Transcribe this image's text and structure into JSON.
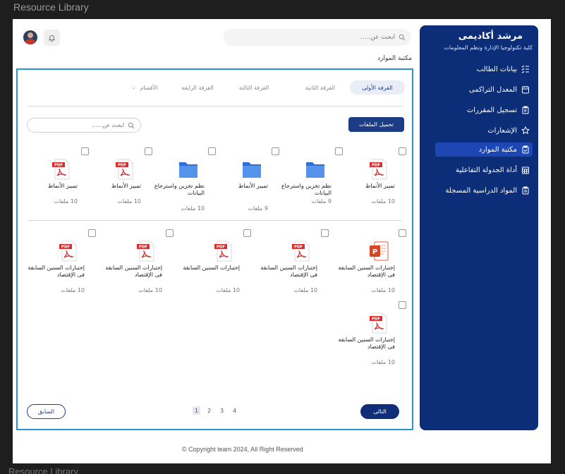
{
  "window": {
    "title": "Resource Library",
    "bottom_title": "Resource Library"
  },
  "sidebar": {
    "title": "مرشد أكاديمى",
    "subtitle": "كلية تكنولوجيا الإدارة ونظم المعلومات",
    "items": [
      {
        "label": "بيانات الطالب",
        "icon": "list-check-icon"
      },
      {
        "label": "المعدل التراكمى",
        "icon": "calendar-icon"
      },
      {
        "label": "تسجيل المقررات",
        "icon": "clipboard-icon"
      },
      {
        "label": "الإشعارات",
        "icon": "star-icon"
      },
      {
        "label": "مكتبة الموارد",
        "icon": "clipboard-icon",
        "active": true
      },
      {
        "label": "أداة الجدولة التفاعلية",
        "icon": "calendar-grid-icon"
      },
      {
        "label": "المواد الدراسية  المسجلة",
        "icon": "clipboard-icon"
      }
    ]
  },
  "header": {
    "search_placeholder": "ابحث عن.....",
    "breadcrumb": "مكتبة الموارد"
  },
  "tabs": [
    {
      "label": "الفرقة الأولى",
      "active": true
    },
    {
      "label": "الفرقة الثانية"
    },
    {
      "label": "الفرقة الثالثة"
    },
    {
      "label": "الفرقة الرابعة"
    },
    {
      "label": "الأقسام"
    }
  ],
  "toolbar": {
    "upload_label": "تحميل الملفات",
    "search_placeholder": "ابحث عن......"
  },
  "row1": [
    {
      "type": "pdf",
      "name": "تمييز الأنماط",
      "count": "10 ملفات"
    },
    {
      "type": "folder",
      "name": "نظم تخزين واسترجاع البيانات",
      "count": "9 ملفات"
    },
    {
      "type": "folder",
      "name": "تمييز الأنماط",
      "count": "9 ملفات"
    },
    {
      "type": "folder",
      "name": "نظم تخزين واسترجاع البيانات",
      "count": "10 ملفات"
    },
    {
      "type": "pdf",
      "name": "تمييز الأنماط",
      "count": "10 ملفات"
    },
    {
      "type": "pdf",
      "name": "تمييز الأنماط",
      "count": "10 ملفات"
    }
  ],
  "row2": [
    {
      "type": "ppt",
      "name": "إختبارات السنين السابقة فى الإقتصاد",
      "count": "10 ملفات"
    },
    {
      "type": "pdf",
      "name": "إختبارات السنين السابقة فى الإقتصاد",
      "count": "10 ملفات"
    },
    {
      "type": "pdf",
      "name": "إختبارات السنين السابقة",
      "count": "10 ملفات"
    },
    {
      "type": "pdf",
      "name": "إختبارات السنين السابقة فى الإقتصاد",
      "count": "10 ملفات"
    },
    {
      "type": "pdf",
      "name": "إختبارات السنين السابقة فى الإقتصاد",
      "count": "10 ملفات"
    }
  ],
  "row3": [
    {
      "type": "pdf",
      "name": "إختبارات السنين السابقة فى الإقتصاد",
      "count": "10 ملفات"
    }
  ],
  "pagination": {
    "pages": [
      "1",
      "2",
      "3",
      "4"
    ],
    "current": "1",
    "next_label": "التالى",
    "prev_label": "السابق"
  },
  "footer": {
    "copyright": "© Copyright team 2024, All Right Reserved"
  },
  "colors": {
    "primary": "#0c2d78",
    "accent": "#2993d8",
    "pdf": "#d32f2f",
    "folder": "#3d7be0"
  }
}
